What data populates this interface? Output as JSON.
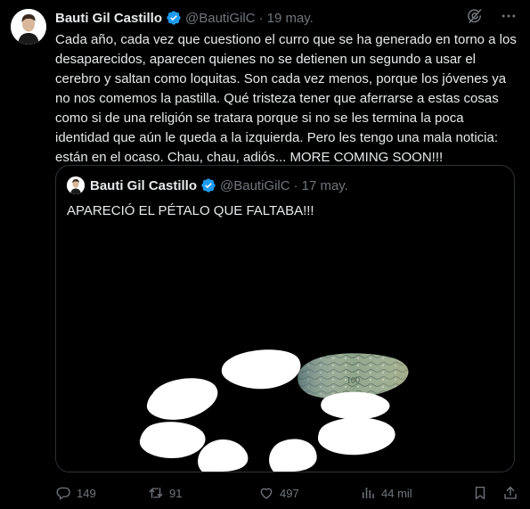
{
  "tweet": {
    "author_name": "Bauti Gil Castillo",
    "handle": "@BautiGilC",
    "separator": "·",
    "date": "19 may.",
    "text": "Cada año, cada vez que cuestiono el curro que se ha generado en torno a los desaparecidos, aparecen quienes no se detienen un segundo a usar el cerebro y saltan como loquitas. Son cada vez menos, porque los jóvenes ya no nos comemos la pastilla. Qué tristeza tener que aferrarse a estas cosas como si de una religión se tratara porque si no se les termina la poca identidad que aún le queda a la izquierda. Pero les tengo una mala noticia: están en el ocaso. Chau, chau, adiós... MORE COMING SOON!!!",
    "icons": {
      "grok": "grok-icon",
      "more": "more-icon"
    }
  },
  "quoted": {
    "author_name": "Bauti Gil Castillo",
    "handle": "@BautiGilC",
    "separator": "·",
    "date": "17 may.",
    "text": "APARECIÓ EL PÉTALO QUE FALTABA!!!"
  },
  "actions": {
    "replies": "149",
    "retweets": "91",
    "likes": "497",
    "views": "44 mil"
  },
  "colors": {
    "background": "#000000",
    "text": "#e7e9ea",
    "muted": "#71767b",
    "verified": "#1d9bf0",
    "border": "#2f3336"
  }
}
